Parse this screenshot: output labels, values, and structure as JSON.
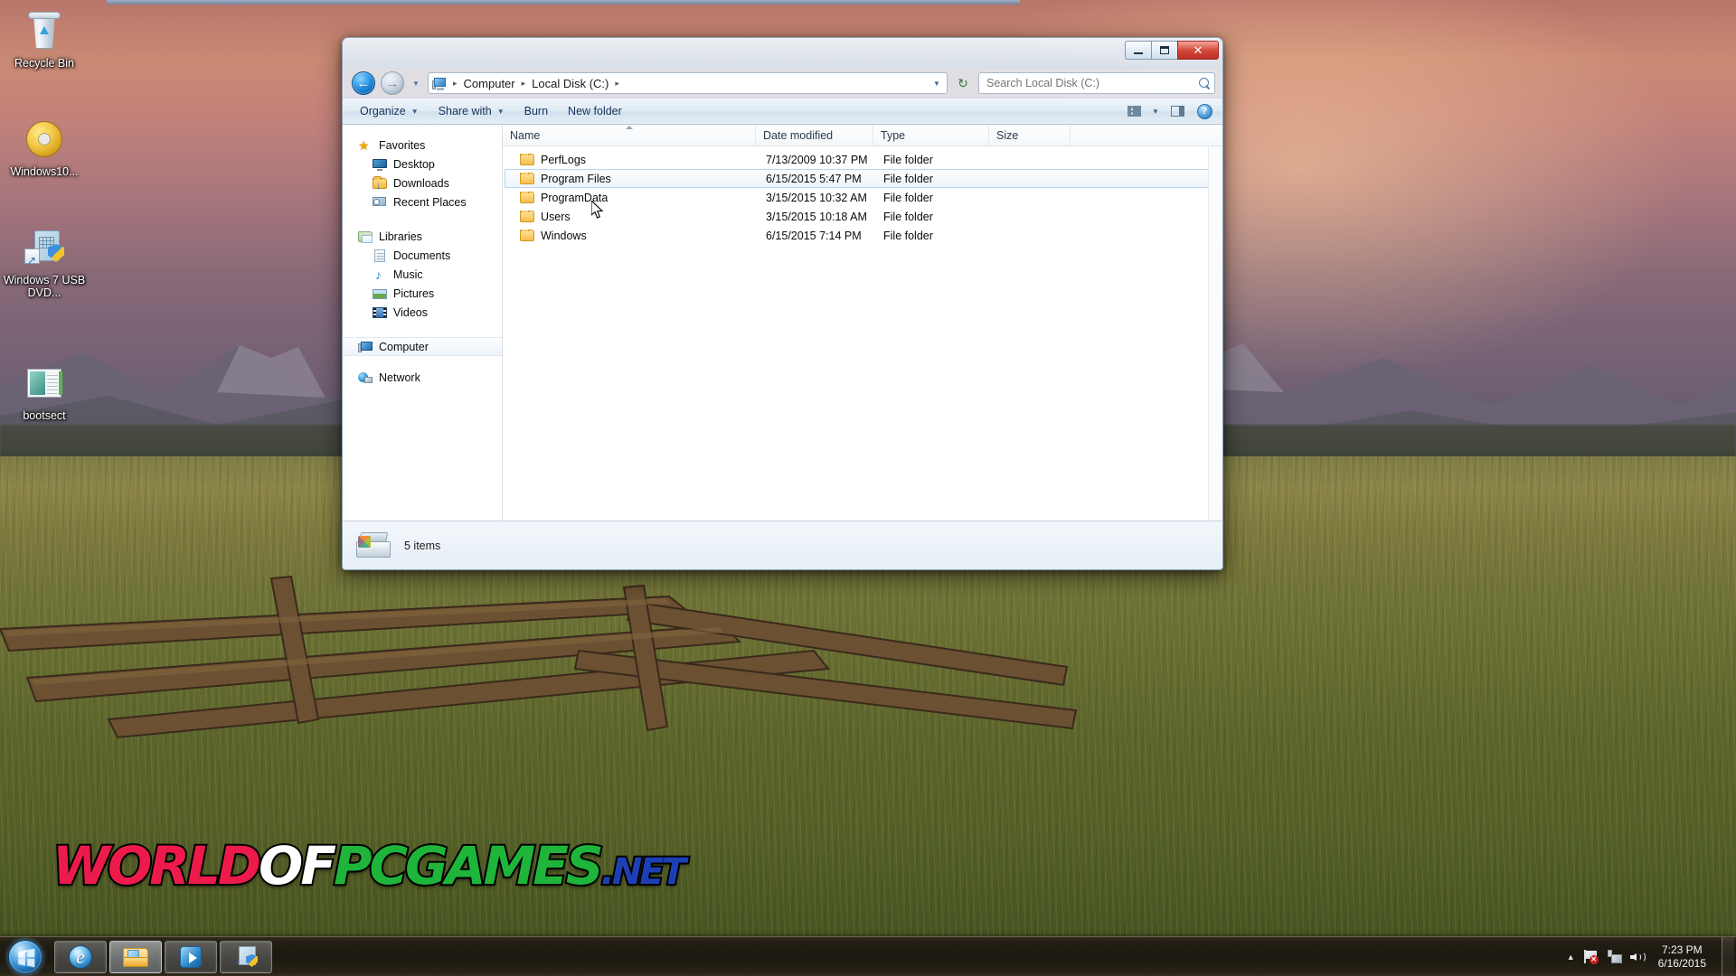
{
  "desktop": {
    "icons": [
      {
        "name": "Recycle Bin",
        "icon": "recycle-bin-icon"
      },
      {
        "name": "Windows10...",
        "icon": "disc-image-icon"
      },
      {
        "name": "Windows 7 USB DVD...",
        "icon": "windows7-usb-dvd-tool-icon"
      },
      {
        "name": "bootsect",
        "icon": "bootsect-application-icon"
      }
    ],
    "watermark": {
      "part1": "WORLD",
      "part2": "OF",
      "part3": "PCGAMES",
      "part4": ".NET"
    }
  },
  "explorer": {
    "window_buttons": {
      "minimize": "_",
      "maximize": "□",
      "close": "✕"
    },
    "navigation": {
      "back_label": "←",
      "forward_label": "→",
      "history_label": "▼"
    },
    "address": {
      "icon": "computer-icon",
      "crumbs": [
        "Computer",
        "Local Disk (C:)"
      ],
      "separator": "▸",
      "dropdown": "▼",
      "refresh_label": "↻"
    },
    "search": {
      "placeholder": "Search Local Disk (C:)",
      "value": "",
      "icon": "search-icon"
    },
    "toolbar": {
      "items": [
        {
          "label": "Organize",
          "has_caret": true
        },
        {
          "label": "Share with",
          "has_caret": true
        },
        {
          "label": "Burn",
          "has_caret": false
        },
        {
          "label": "New folder",
          "has_caret": false
        }
      ],
      "view_icon": "view-options-icon",
      "view_caret": "▼",
      "preview_icon": "preview-pane-icon",
      "help_icon": "help-icon",
      "help_label": "?"
    },
    "nav_pane": {
      "groups": [
        {
          "header": {
            "label": "Favorites",
            "icon": "favorites-star-icon"
          },
          "items": [
            {
              "label": "Desktop",
              "icon": "desktop-icon"
            },
            {
              "label": "Downloads",
              "icon": "downloads-folder-icon"
            },
            {
              "label": "Recent Places",
              "icon": "recent-places-icon"
            }
          ]
        },
        {
          "header": {
            "label": "Libraries",
            "icon": "libraries-icon"
          },
          "items": [
            {
              "label": "Documents",
              "icon": "documents-icon"
            },
            {
              "label": "Music",
              "icon": "music-icon"
            },
            {
              "label": "Pictures",
              "icon": "pictures-icon"
            },
            {
              "label": "Videos",
              "icon": "videos-icon"
            }
          ]
        }
      ],
      "computer": {
        "label": "Computer",
        "icon": "computer-icon",
        "selected": true
      },
      "network": {
        "label": "Network",
        "icon": "network-icon",
        "selected": false
      }
    },
    "columns": [
      {
        "label": "Name",
        "sorted": true
      },
      {
        "label": "Date modified",
        "sorted": false
      },
      {
        "label": "Type",
        "sorted": false
      },
      {
        "label": "Size",
        "sorted": false
      }
    ],
    "rows": [
      {
        "name": "PerfLogs",
        "date": "7/13/2009 10:37 PM",
        "type": "File folder",
        "size": "",
        "selected": false
      },
      {
        "name": "Program Files",
        "date": "6/15/2015 5:47 PM",
        "type": "File folder",
        "size": "",
        "selected": true
      },
      {
        "name": "ProgramData",
        "date": "3/15/2015 10:32 AM",
        "type": "File folder",
        "size": "",
        "selected": false
      },
      {
        "name": "Users",
        "date": "3/15/2015 10:18 AM",
        "type": "File folder",
        "size": "",
        "selected": false
      },
      {
        "name": "Windows",
        "date": "6/15/2015 7:14 PM",
        "type": "File folder",
        "size": "",
        "selected": false
      }
    ],
    "details": {
      "icon": "local-disk-icon",
      "text": "5 items"
    }
  },
  "taskbar": {
    "start_button": {
      "icon": "windows-start-orb-icon"
    },
    "buttons": [
      {
        "icon": "internet-explorer-icon",
        "active": false
      },
      {
        "icon": "windows-explorer-icon",
        "active": true
      },
      {
        "icon": "windows-media-player-icon",
        "active": false
      },
      {
        "icon": "download-tool-icon",
        "active": false
      }
    ],
    "tray": {
      "show_hidden": "▲",
      "action_center_icon": "action-center-flag-icon",
      "network_icon": "network-tray-icon",
      "volume_icon": "volume-icon",
      "time": "7:23 PM",
      "date": "6/16/2015"
    }
  }
}
